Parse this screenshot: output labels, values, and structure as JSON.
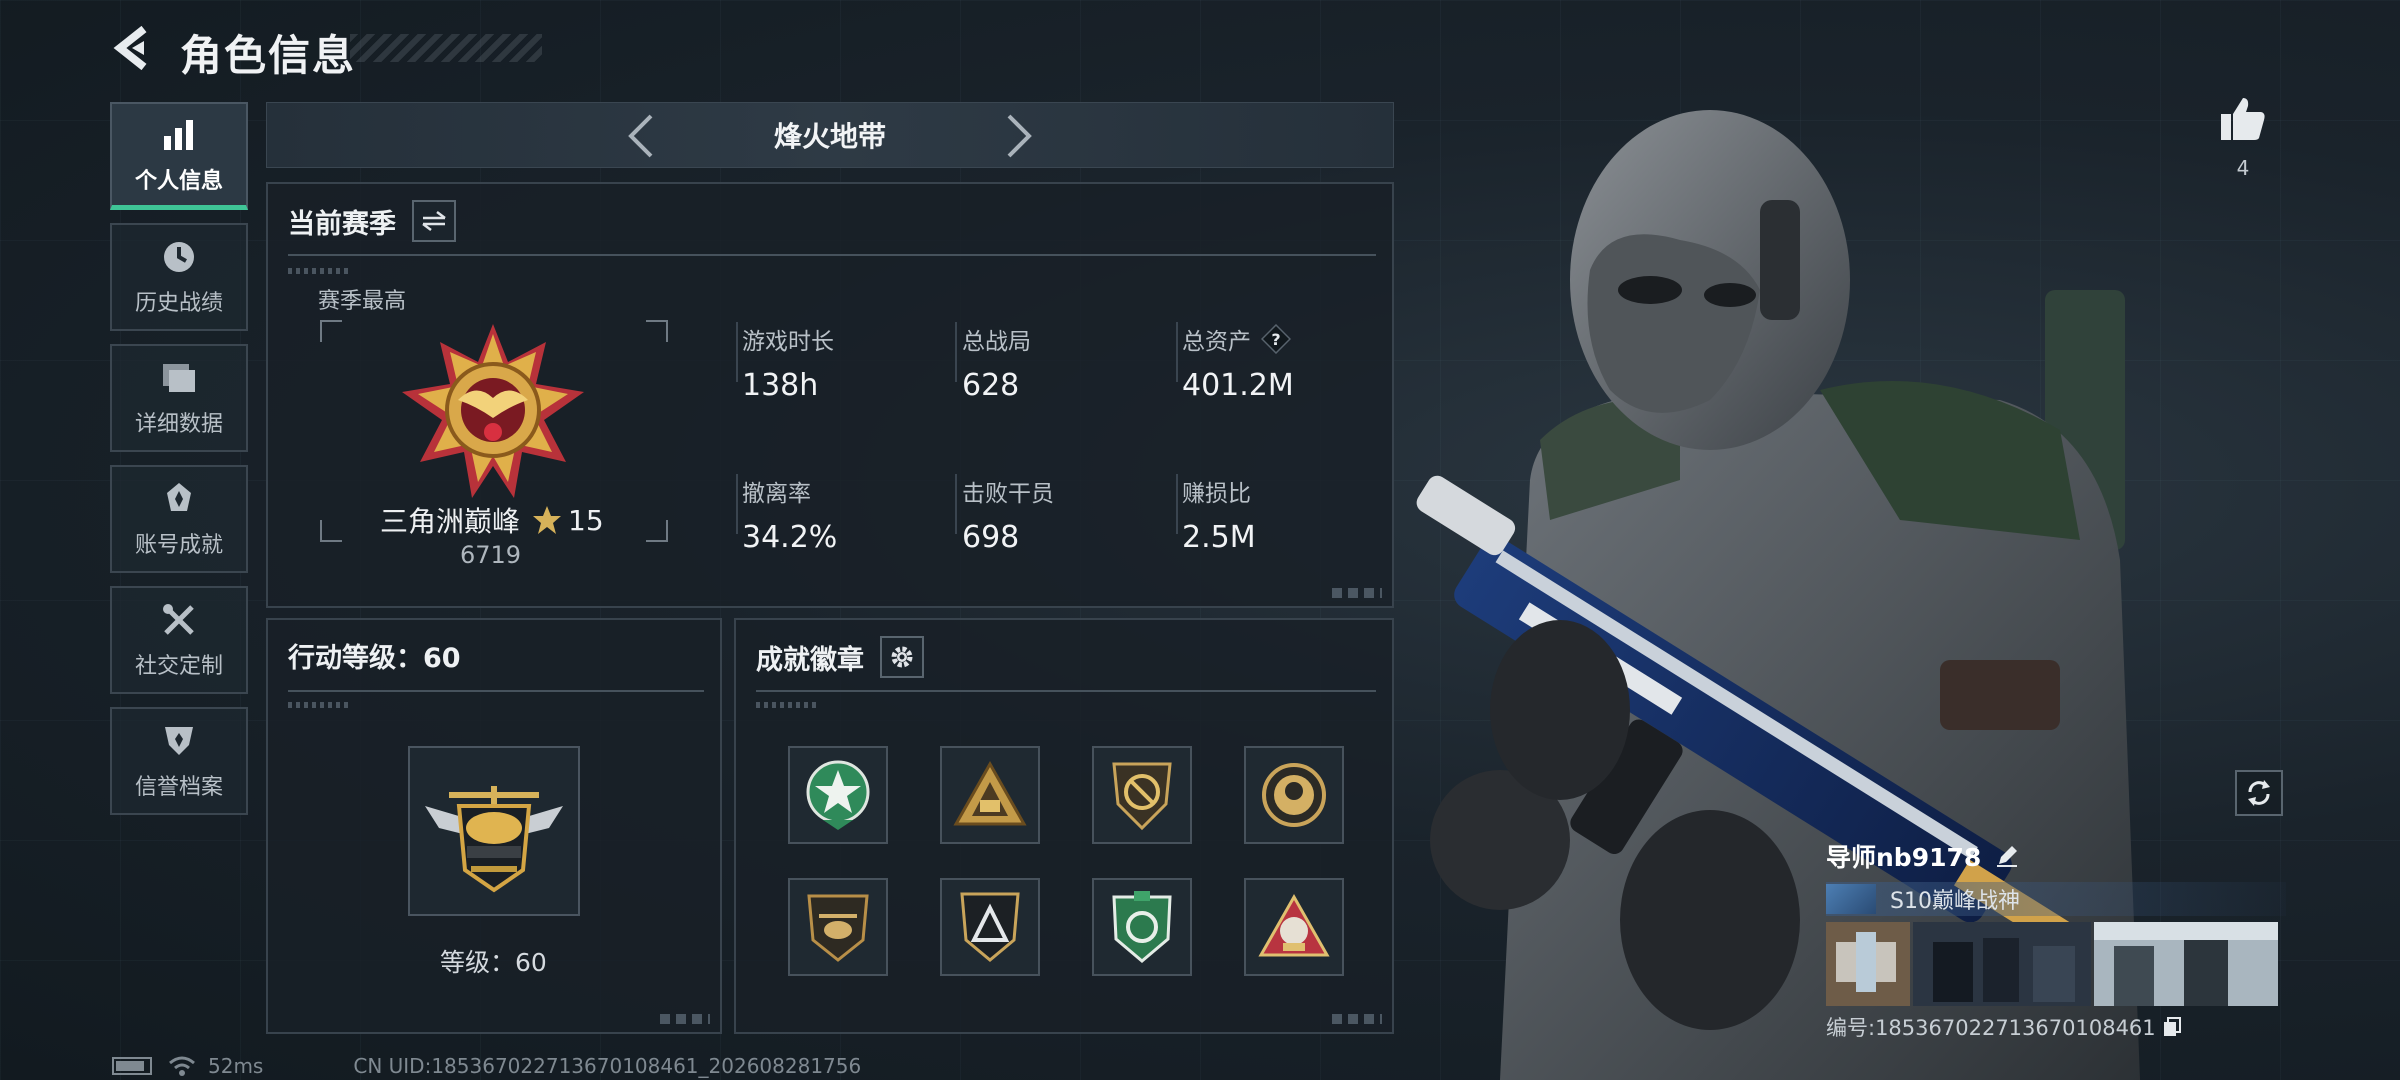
{
  "header": {
    "title": "角色信息"
  },
  "sidebar": {
    "items": [
      {
        "label": "个人信息",
        "icon": "bar-chart-icon",
        "active": true
      },
      {
        "label": "历史战绩",
        "icon": "clock-icon"
      },
      {
        "label": "详细数据",
        "icon": "folder-icon"
      },
      {
        "label": "账号成就",
        "icon": "achievement-icon"
      },
      {
        "label": "社交定制",
        "icon": "tools-icon"
      },
      {
        "label": "信誉档案",
        "icon": "shield-icon"
      }
    ]
  },
  "mode": {
    "title": "烽火地带"
  },
  "season": {
    "title": "当前赛季",
    "best_label": "赛季最高",
    "rank_name": "三角洲巅峰",
    "rank_stars": "15",
    "rank_score": "6719",
    "stats": [
      {
        "label": "游戏时长",
        "value": "138h"
      },
      {
        "label": "总战局",
        "value": "628"
      },
      {
        "label": "总资产",
        "value": "401.2M"
      },
      {
        "label": "撤离率",
        "value": "34.2%"
      },
      {
        "label": "击败干员",
        "value": "698"
      },
      {
        "label": "赚损比",
        "value": "2.5M"
      }
    ]
  },
  "action_level": {
    "title": "行动等级：60",
    "level_label": "等级：60"
  },
  "achievements": {
    "title": "成就徽章"
  },
  "like": {
    "count": "4"
  },
  "player": {
    "name": "导师nb9178",
    "title": "S10巅峰战神",
    "id_label": "编号:185367022713670108461"
  },
  "status": {
    "ping": "52ms",
    "uid": "CN UID:185367022713670108461_202608281756"
  },
  "colors": {
    "accent": "#3fc597",
    "panel_bg": "#182027",
    "border": "#38434d"
  }
}
